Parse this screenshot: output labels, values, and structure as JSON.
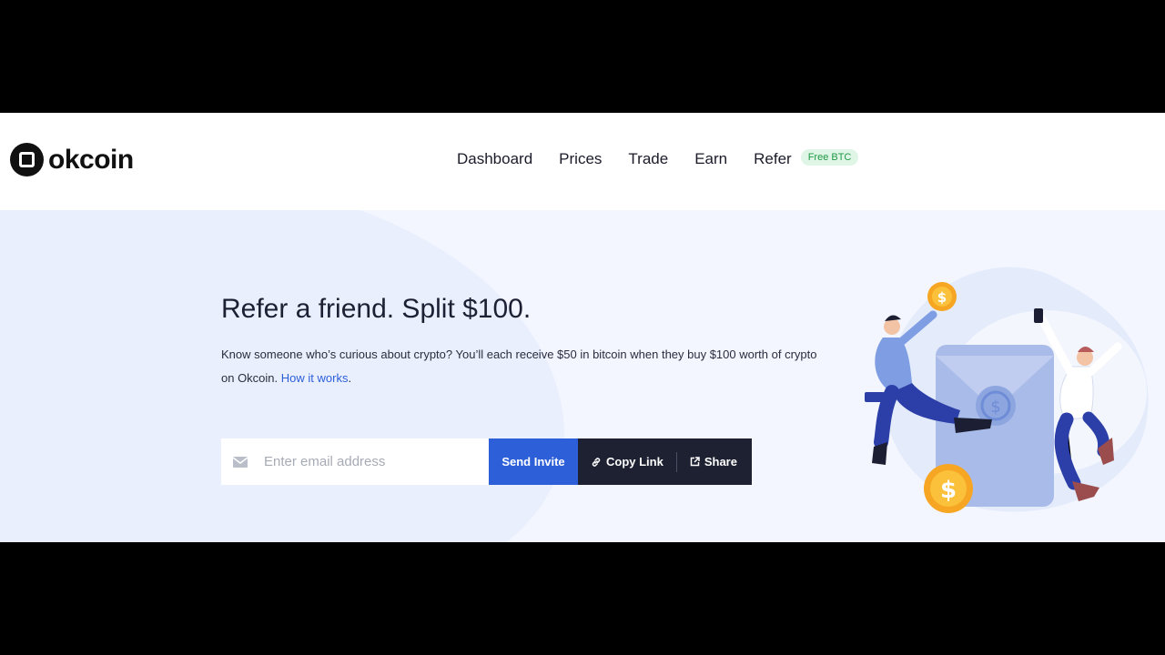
{
  "header": {
    "logo_text": "okcoin",
    "nav": [
      "Dashboard",
      "Prices",
      "Trade",
      "Earn"
    ],
    "refer_label": "Refer",
    "refer_badge": "Free BTC"
  },
  "hero": {
    "headline": "Refer a friend. Split $100.",
    "description": "Know someone who’s curious about crypto? You’ll each receive $50 in bitcoin when they buy $100 worth of crypto on Okcoin.",
    "how_it_works": "How it works",
    "trailing_period": "."
  },
  "form": {
    "email_placeholder": "Enter email address",
    "send_label": "Send Invite",
    "copy_label": "Copy Link",
    "share_label": "Share"
  },
  "colors": {
    "primary": "#2d5fd9",
    "dark": "#1d2132",
    "badge_bg": "#dff5e6",
    "badge_text": "#1f9a45",
    "hero_bg": "#f3f6fe"
  },
  "icons": [
    "mail-icon",
    "link-icon",
    "share-icon"
  ]
}
